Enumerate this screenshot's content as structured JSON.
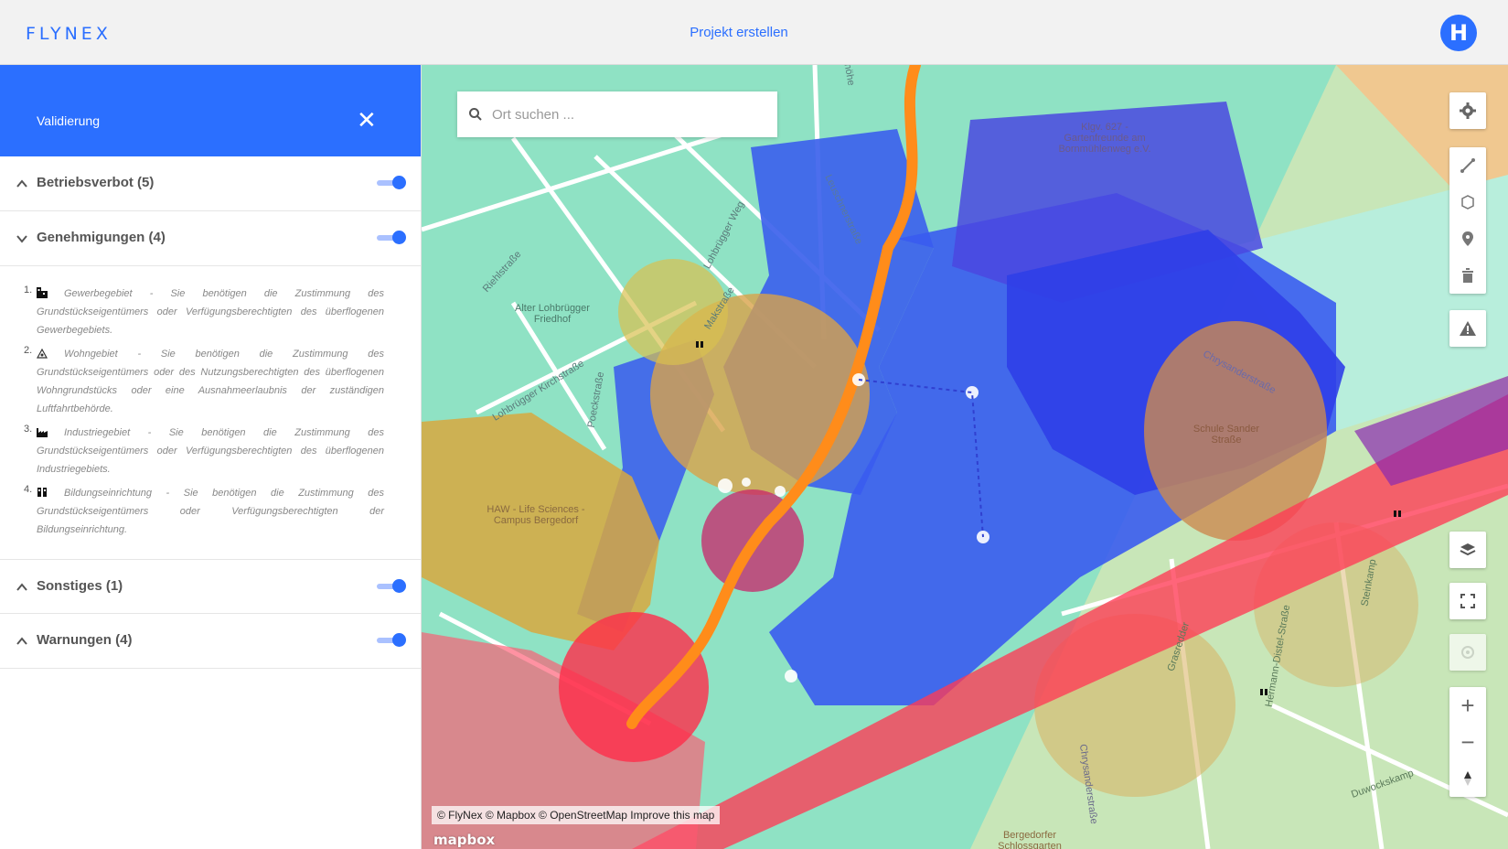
{
  "app": {
    "logo": "FLYNEX",
    "page_title": "Projekt erstellen",
    "avatar_glyph": "H"
  },
  "colors": {
    "brand": "#2b6fff",
    "no_fly": "#ff3b5c",
    "permit": "#e8b83a",
    "warning": "#3b5bff"
  },
  "sidebar": {
    "title": "Validierung",
    "close_glyph": "✕",
    "sections": [
      {
        "label": "Betriebsverbot (5)",
        "expanded": false,
        "enabled": true
      },
      {
        "label": "Genehmigungen (4)",
        "expanded": true,
        "enabled": true
      },
      {
        "label": "Sonstiges (1)",
        "expanded": false,
        "enabled": true
      },
      {
        "label": "Warnungen (4)",
        "expanded": false,
        "enabled": true
      }
    ],
    "permits": [
      {
        "num": "1.",
        "icon": "commercial-building-icon",
        "text": "Gewerbegebiet - Sie benötigen die Zustimmung des Grundstückseigentümers oder Verfügungsberechtigten des überflogenen Gewerbegebiets."
      },
      {
        "num": "2.",
        "icon": "residential-icon",
        "text": "Wohngebiet - Sie benötigen die Zustimmung des Grundstückseigentümers oder des Nutzungsberechtigten des überflogenen Wohngrundstücks oder eine Ausnahmeerlaubnis der zuständigen Luftfahrtbehörde."
      },
      {
        "num": "3.",
        "icon": "factory-icon",
        "text": "Industriegebiet - Sie benötigen die Zustimmung des Grundstückseigentümers oder Verfügungsberechtigten des überflogenen Industriegebiets."
      },
      {
        "num": "4.",
        "icon": "school-icon",
        "text": "Bildungseinrichtung - Sie benötigen die Zustimmung des Grundstückseigentümers oder Verfügungsberechtigten der Bildungseinrichtung."
      }
    ]
  },
  "map": {
    "search_placeholder": "Ort suchen ...",
    "attribution": "© FlyNex © Mapbox © OpenStreetMap Improve this map",
    "mapbox_logo": "mapbox",
    "labels": {
      "riehlstrasse": "Riehlstraße",
      "friedhof": "Alter Lohbrügger Friedhof",
      "kirchstrasse": "Lohbrügger Kirchstraße",
      "poeckstrasse": "Poeckstraße",
      "lohbruegger_weg": "Lohbrügger Weg",
      "makstrasse": "Makstraße",
      "leuschnerstrasse": "Leuschnerstraße",
      "haw": "HAW - Life Sciences - Campus Bergedorf",
      "kleingarten": "Klgv. 627 - Gartenfreunde am Bornmühlenweg e.V.",
      "chrysanderstrasse": "Chrysanderstraße",
      "schule": "Schule Sander Straße",
      "grasredder": "Grasredder",
      "hermann_distel": "Hermann-Distel-Straße",
      "steinkamp": "Steinkamp",
      "duwockskamp": "Duwockskamp",
      "chrysanderstrasse2": "Chrysanderstraße",
      "schlossgarten": "Bergedorfer Schlossgarten",
      "mohlenhoehe": "mhöhe"
    }
  },
  "controls": {
    "settings": "gear-icon",
    "draw_line": "line-draw-icon",
    "draw_polygon": "polygon-draw-icon",
    "place_marker": "marker-icon",
    "delete": "trash-icon",
    "warning": "warning-icon",
    "layers": "layers-icon",
    "fullscreen": "fullscreen-icon",
    "geolocate": "geolocate-icon",
    "zoom_in": "+",
    "zoom_out": "−",
    "compass": "compass-icon"
  }
}
